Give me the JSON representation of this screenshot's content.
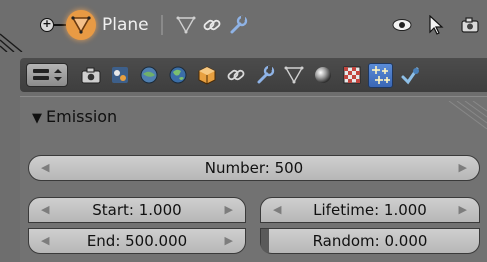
{
  "header": {
    "object_name": "Plane",
    "icons": [
      "plus-icon",
      "mesh-object-icon",
      "mesh-data-icon",
      "constraint-link-icon",
      "modifier-wrench-icon",
      "eye-icon",
      "cursor-arrow-icon",
      "camera-icon"
    ]
  },
  "tabbar": {
    "menu_icon": "panel-menu-icon",
    "tabs": [
      {
        "icon": "render-camera-icon",
        "active": false
      },
      {
        "icon": "render-layers-icon",
        "active": false
      },
      {
        "icon": "scene-icon",
        "active": false
      },
      {
        "icon": "world-icon",
        "active": false
      },
      {
        "icon": "object-cube-icon",
        "active": false
      },
      {
        "icon": "constraints-link-icon",
        "active": false
      },
      {
        "icon": "modifiers-wrench-icon",
        "active": false
      },
      {
        "icon": "mesh-data-icon",
        "active": false
      },
      {
        "icon": "material-sphere-icon",
        "active": false
      },
      {
        "icon": "texture-checker-icon",
        "active": false
      },
      {
        "icon": "particles-icon",
        "active": true
      },
      {
        "icon": "physics-icon",
        "active": false
      }
    ]
  },
  "panel": {
    "title": "Emission",
    "number": "Number: 500",
    "start": "Start: 1.000",
    "end": "End: 500.000",
    "lifetime": "Lifetime: 1.000",
    "random": "Random: 0.000",
    "random_fraction": 0.0
  },
  "colors": {
    "background": "#6e6e6e",
    "field": "#c4c4c4",
    "active_tab": "#4a7bc9",
    "object_highlight": "#e89a44"
  }
}
